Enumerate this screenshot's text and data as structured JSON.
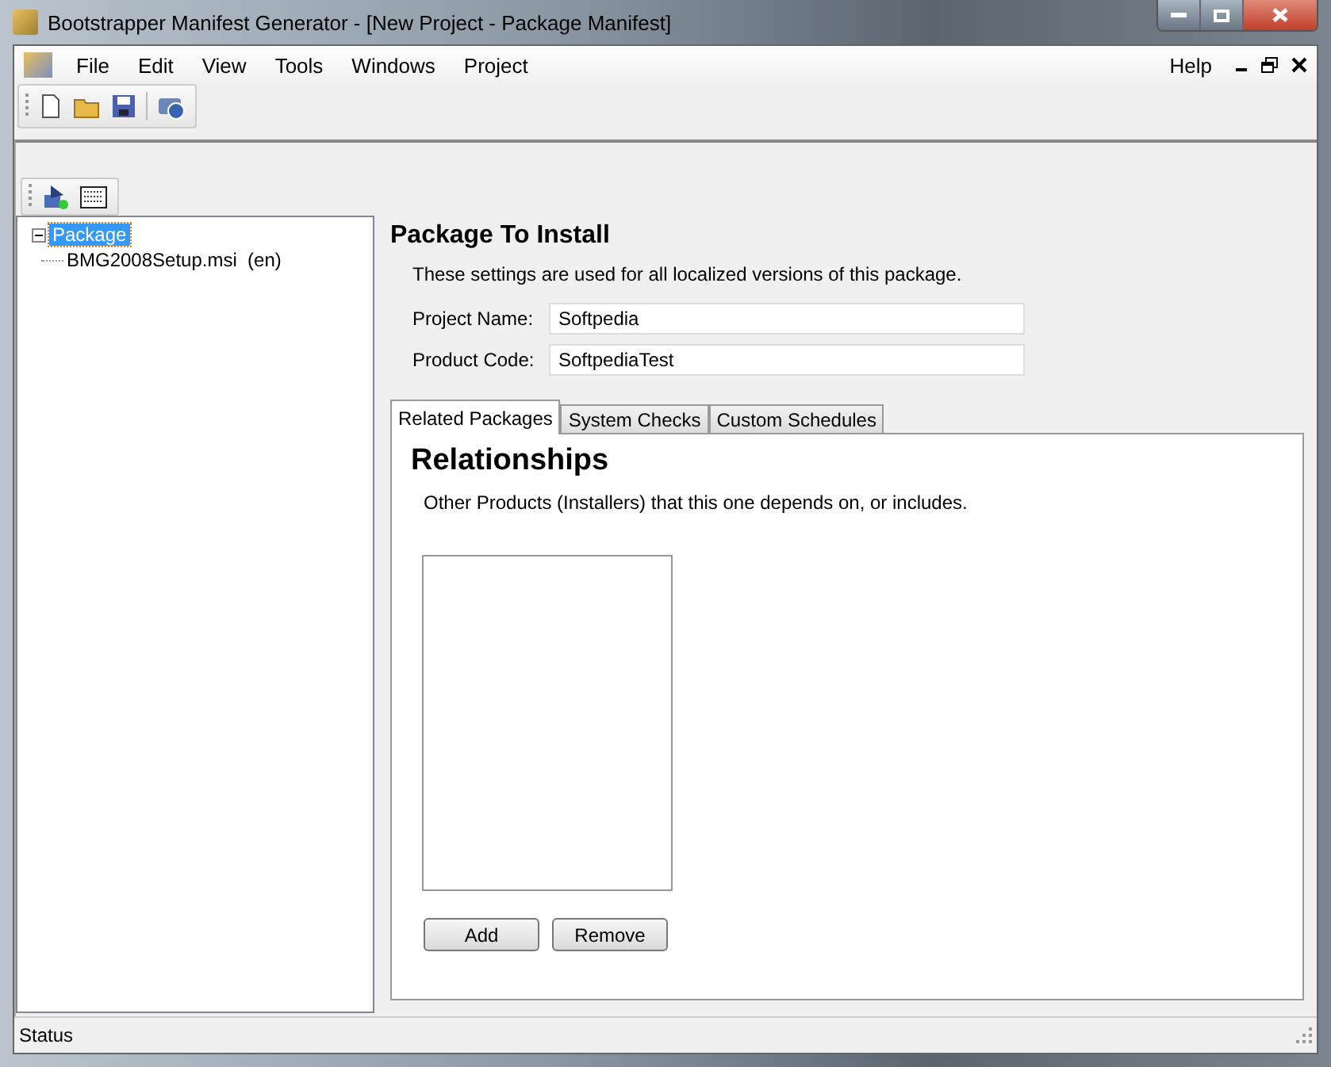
{
  "window": {
    "title": "Bootstrapper Manifest Generator - [New Project - Package Manifest]"
  },
  "menu": {
    "items": [
      "File",
      "Edit",
      "View",
      "Tools",
      "Windows",
      "Project"
    ],
    "help": "Help"
  },
  "toolbar": {
    "buttons": [
      {
        "kind": "new"
      },
      {
        "kind": "open"
      },
      {
        "kind": "save"
      },
      {
        "kind": "help"
      }
    ]
  },
  "sub_toolbar": {
    "buttons": [
      {
        "kind": "add-package"
      },
      {
        "kind": "grid"
      }
    ]
  },
  "tree": [
    {
      "label": "Package",
      "selected": true,
      "expanded": true,
      "children": [
        {
          "label": "BMG2008Setup.msi  (en)",
          "selected": false
        }
      ]
    }
  ],
  "panel": {
    "title": "Package To Install",
    "description": "These settings are used for all localized versions of this package.",
    "fields": [
      {
        "label": "Project Name:",
        "value": "Softpedia"
      },
      {
        "label": "Product Code:",
        "value": "SoftpediaTest"
      }
    ],
    "tabs": [
      {
        "label": "Related Packages",
        "selected": true
      },
      {
        "label": "System Checks",
        "selected": false
      },
      {
        "label": "Custom Schedules",
        "selected": false
      }
    ],
    "tab_page": {
      "title": "Relationships",
      "description": "Other Products (Installers) that this one depends on, or includes.",
      "buttons": [
        "Add",
        "Remove"
      ]
    }
  },
  "status_bar": "Status"
}
